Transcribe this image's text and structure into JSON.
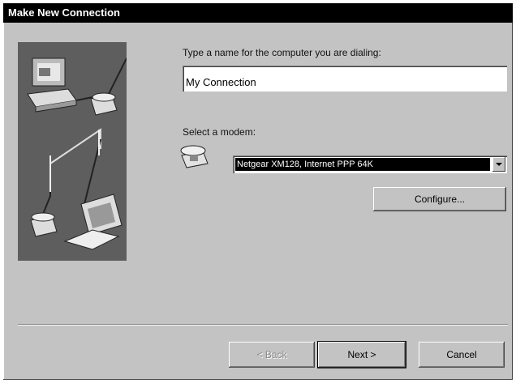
{
  "window": {
    "title": "Make New Connection"
  },
  "form": {
    "name_label": "Type a name for the computer you are dialing:",
    "name_value": "My Connection",
    "modem_label": "Select a modem:",
    "modem_value": "Netgear XM128, Internet PPP 64K",
    "configure_label": "Configure..."
  },
  "buttons": {
    "back": "< Back",
    "next": "Next >",
    "cancel": "Cancel"
  },
  "icons": {
    "illustration": "computer-phone-laptop-connection-illustration",
    "modem": "telephone-icon"
  }
}
